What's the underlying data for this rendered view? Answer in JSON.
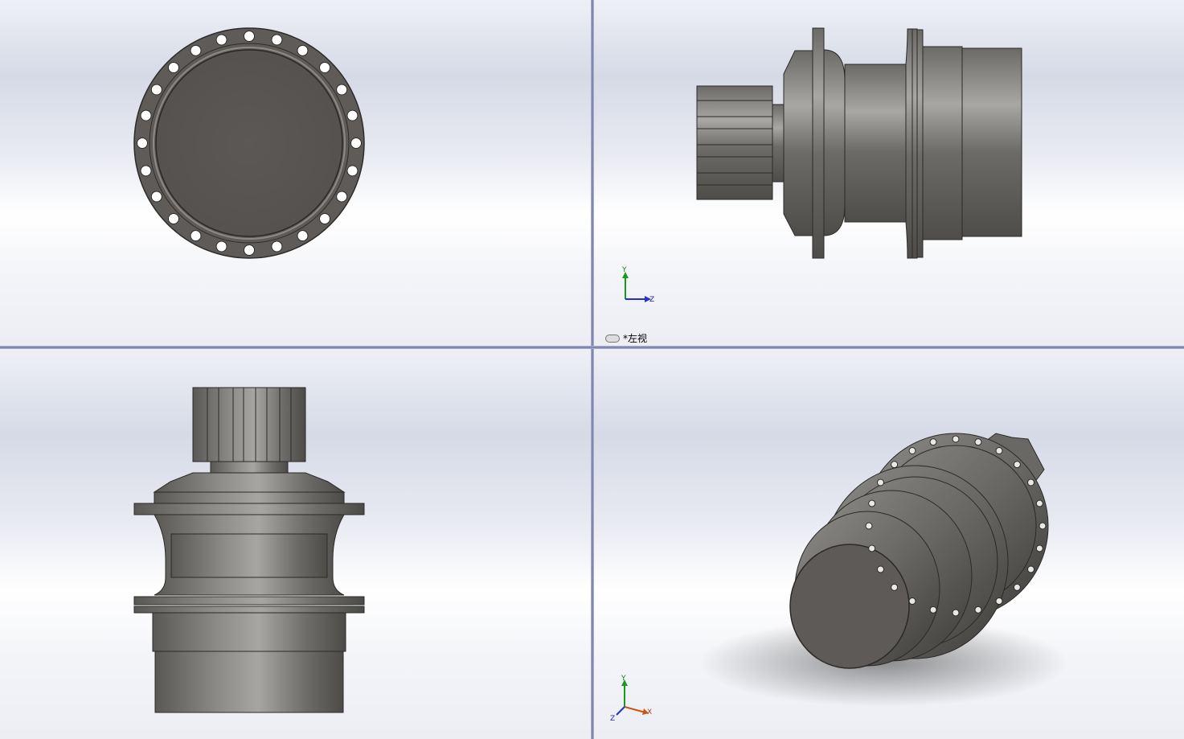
{
  "views": {
    "top_right": {
      "label": "*左视"
    }
  },
  "triad": {
    "top_right": {
      "y": "Y",
      "z": "Z",
      "x": "X"
    },
    "bottom_right": {
      "y": "Y",
      "z": "Z",
      "x": "X"
    }
  },
  "colors": {
    "part_dark": "#5a5754",
    "part_mid": "#7a7875",
    "part_light": "#b9b7b3",
    "axis_y": "#1a9a1a",
    "axis_z": "#2233cc",
    "axis_x": "#cc5511"
  }
}
